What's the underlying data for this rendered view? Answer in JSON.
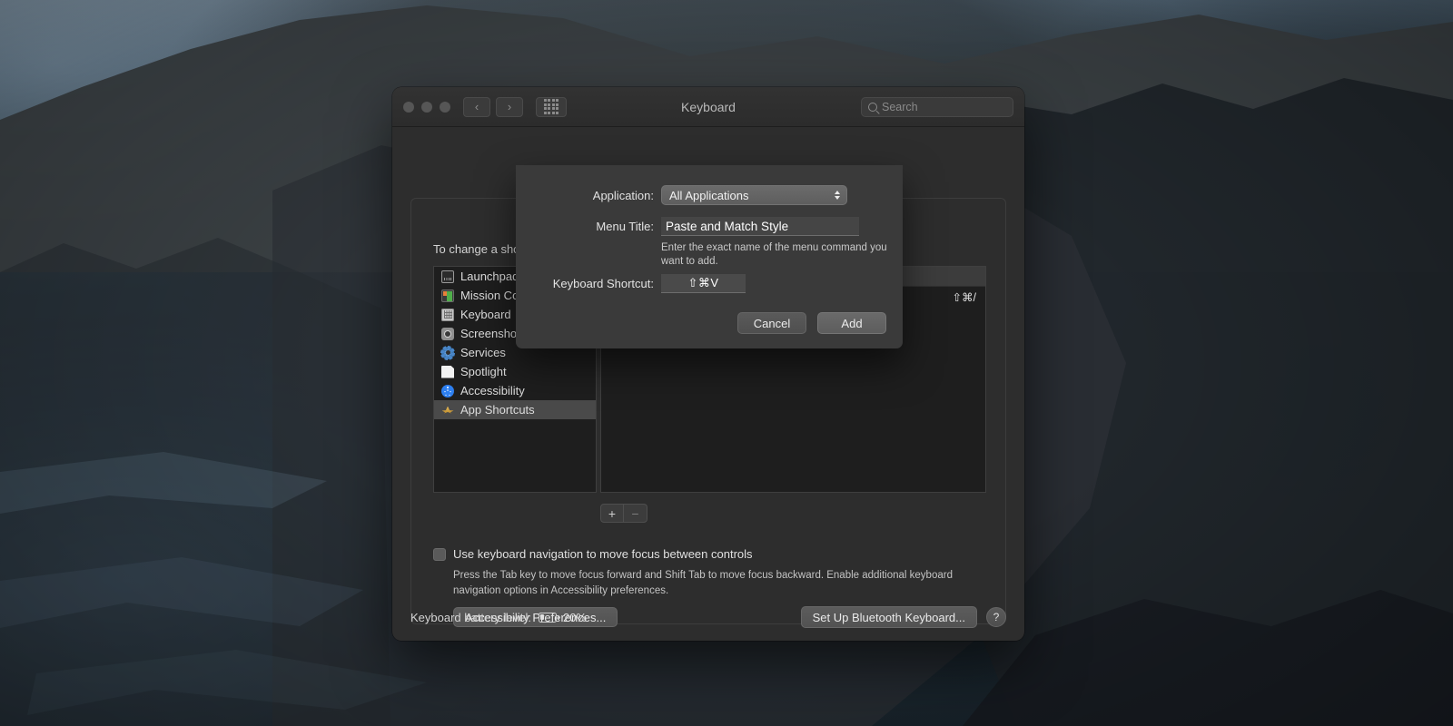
{
  "window": {
    "title": "Keyboard",
    "traffic_lights": [
      "close",
      "minimize",
      "zoom"
    ],
    "nav_back": "‹",
    "nav_forward": "›",
    "grid_button": "show-all-icon",
    "search": {
      "placeholder": "Search",
      "value": ""
    }
  },
  "panel": {
    "instructions": "To change a shortcut, select it, click the key combination, and then type the new keys.",
    "categories": [
      {
        "label": "Launchpad & Dock",
        "icon": "launchpad-icon",
        "selected": false
      },
      {
        "label": "Mission Control",
        "icon": "mission-control-icon",
        "selected": false
      },
      {
        "label": "Keyboard",
        "icon": "keyboard-icon",
        "selected": false
      },
      {
        "label": "Screenshots",
        "icon": "screenshot-icon",
        "selected": false
      },
      {
        "label": "Services",
        "icon": "services-icon",
        "selected": false
      },
      {
        "label": "Spotlight",
        "icon": "spotlight-icon",
        "selected": false
      },
      {
        "label": "Accessibility",
        "icon": "accessibility-icon",
        "selected": false
      },
      {
        "label": "App Shortcuts",
        "icon": "app-shortcuts-icon",
        "selected": true
      }
    ],
    "shortcuts": [
      {
        "name": "",
        "keys": "⇧⌘/"
      }
    ],
    "add_button": "+",
    "remove_button": "−"
  },
  "keyboard_navigation": {
    "checkbox_label": "Use keyboard navigation to move focus between controls",
    "checked": false,
    "help_text": "Press the Tab key to move focus forward and Shift Tab to move focus backward. Enable additional keyboard navigation options in Accessibility preferences.",
    "accessibility_button": "Accessibility Preferences..."
  },
  "bottom_bar": {
    "battery_label": "Keyboard battery level:",
    "battery_percent": "20%",
    "battery_level": 20,
    "bluetooth_button": "Set Up Bluetooth Keyboard...",
    "help_button": "?"
  },
  "sheet": {
    "application_label": "Application:",
    "application_value": "All Applications",
    "menu_title_label": "Menu Title:",
    "menu_title_value": "Paste and Match Style",
    "menu_title_hint": "Enter the exact name of the menu command you want to add.",
    "shortcut_label": "Keyboard Shortcut:",
    "shortcut_value": "⇧⌘V",
    "cancel_button": "Cancel",
    "add_button": "Add"
  },
  "colors": {
    "window_bg": "#2d2d2d",
    "sheet_bg": "#3a3a3a",
    "list_bg": "#1e1e1e",
    "selection": "#4a4a4a",
    "accent_blue": "#2d7ff0",
    "text_primary": "#e2e2e2",
    "text_secondary": "#c4c4c4"
  }
}
